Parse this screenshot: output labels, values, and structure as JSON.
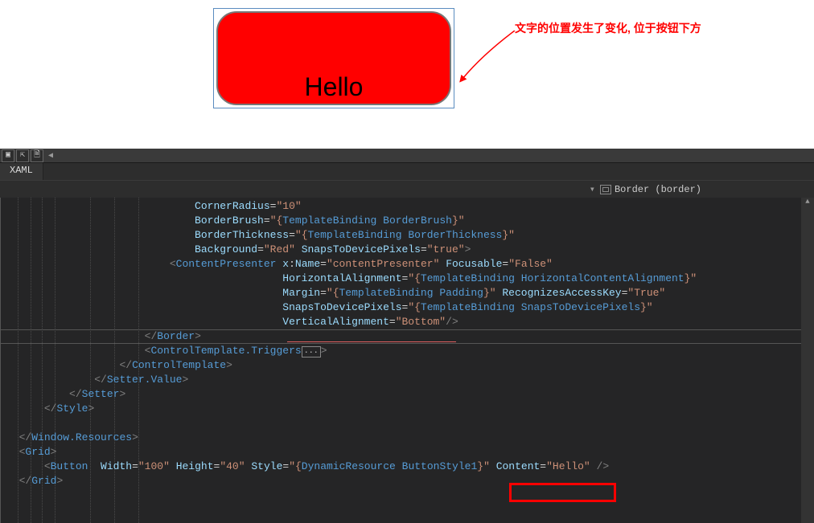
{
  "demo": {
    "button_text": "Hello"
  },
  "annotation": {
    "text": "文字的位置发生了变化, 位于按钮下方"
  },
  "ide": {
    "tab": "XAML",
    "breadcrumb_hint": "Border (border)",
    "toolbar_glyphs": [
      "▣",
      "⇱",
      "🗎"
    ]
  },
  "tokens": {
    "attr": {
      "CornerRadius": "CornerRadius",
      "BorderBrush": "BorderBrush",
      "BorderThickness": "BorderThickness",
      "Background": "Background",
      "SnapsToDevicePixels": "SnapsToDevicePixels",
      "xName": "x",
      "Name": "Name",
      "Focusable": "Focusable",
      "HorizontalAlignment": "HorizontalAlignment",
      "Margin": "Margin",
      "RecognizesAccessKey": "RecognizesAccessKey",
      "VerticalAlignment": "VerticalAlignment",
      "Width": "Width",
      "Height": "Height",
      "Style": "Style",
      "Content": "Content",
      "HorizontalContentAlignment": "HorizontalContentAlignment",
      "Padding": "Padding"
    },
    "str": {
      "ten": "\"10\"",
      "tb_BorderBrush": "\"{",
      "br_kw": "TemplateBinding",
      "BorderBrush": "BorderBrush",
      "close_brace": "}\"",
      "BorderThickness": "BorderThickness",
      "Red": "\"Red\"",
      "true": "\"true\"",
      "contentPresenter": "\"contentPresenter\"",
      "False": "\"False\"",
      "HorizontalContentAlignment": "HorizontalContentAlignment",
      "Padding": "Padding",
      "True": "\"True\"",
      "SnapsToDevicePixels": "SnapsToDevicePixels",
      "Bottom": "\"Bottom\"",
      "hundred": "\"100\"",
      "forty": "\"40\"",
      "dyn_open": "\"{",
      "dyn_kw": "DynamicResource",
      "ButtonStyle1": "ButtonStyle1",
      "Hello": "\"Hello\""
    },
    "el": {
      "ContentPresenter": "ContentPresenter",
      "Border": "Border",
      "ControlTemplate": "ControlTemplate",
      "ControlTemplateTriggers": "ControlTemplate.Triggers",
      "Setter": "Setter",
      "SetterValue": "Setter.Value",
      "Style": "Style",
      "WindowResources": "Window.Resources",
      "Grid": "Grid",
      "Button": "Button"
    },
    "punc": {
      "eq": "=",
      "lt": "<",
      "gt": ">",
      "slash": "/",
      "colon": ":",
      "tb_open": "\"{",
      "close": "}\""
    },
    "collapse": "..."
  }
}
